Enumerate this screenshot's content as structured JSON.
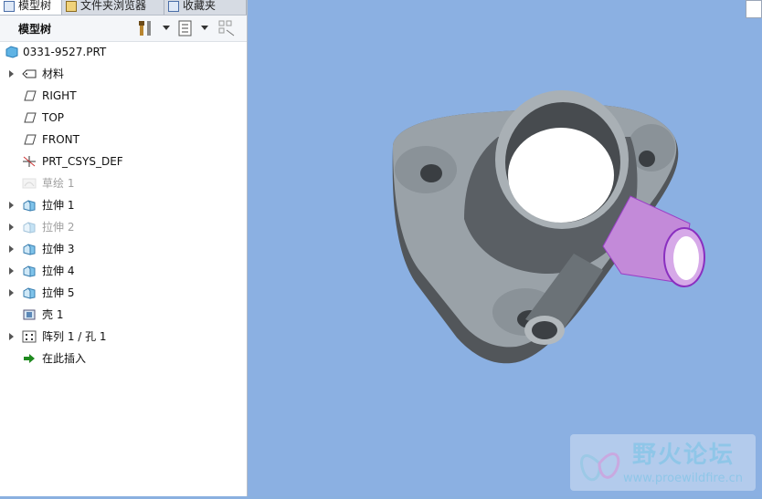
{
  "tabs": [
    {
      "label": "模型树"
    },
    {
      "label": "文件夹浏览器"
    },
    {
      "label": "收藏夹"
    }
  ],
  "toolbar": {
    "title": "模型树"
  },
  "tree": {
    "root": "0331-9527.PRT",
    "items": [
      {
        "label": "材料",
        "expandable": true,
        "dim": false,
        "icon": "material-icon"
      },
      {
        "label": "RIGHT",
        "expandable": false,
        "dim": false,
        "icon": "datum-plane-icon"
      },
      {
        "label": "TOP",
        "expandable": false,
        "dim": false,
        "icon": "datum-plane-icon"
      },
      {
        "label": "FRONT",
        "expandable": false,
        "dim": false,
        "icon": "datum-plane-icon"
      },
      {
        "label": "PRT_CSYS_DEF",
        "expandable": false,
        "dim": false,
        "icon": "csys-icon"
      },
      {
        "label": "草绘 1",
        "expandable": false,
        "dim": true,
        "icon": "sketch-icon"
      },
      {
        "label": "拉伸 1",
        "expandable": true,
        "dim": false,
        "icon": "extrude-icon"
      },
      {
        "label": "拉伸 2",
        "expandable": true,
        "dim": true,
        "icon": "extrude-icon"
      },
      {
        "label": "拉伸 3",
        "expandable": true,
        "dim": false,
        "icon": "extrude-icon"
      },
      {
        "label": "拉伸 4",
        "expandable": true,
        "dim": false,
        "icon": "extrude-icon"
      },
      {
        "label": "拉伸 5",
        "expandable": true,
        "dim": false,
        "icon": "extrude-icon"
      },
      {
        "label": "壳 1",
        "expandable": false,
        "dim": false,
        "icon": "shell-icon"
      },
      {
        "label": "阵列 1 / 孔 1",
        "expandable": true,
        "dim": false,
        "icon": "pattern-icon"
      },
      {
        "label": "在此插入",
        "expandable": false,
        "dim": false,
        "icon": "insert-here-icon"
      }
    ]
  },
  "watermark": {
    "title": "野火论坛",
    "url": "www.proewildfire.cn"
  }
}
